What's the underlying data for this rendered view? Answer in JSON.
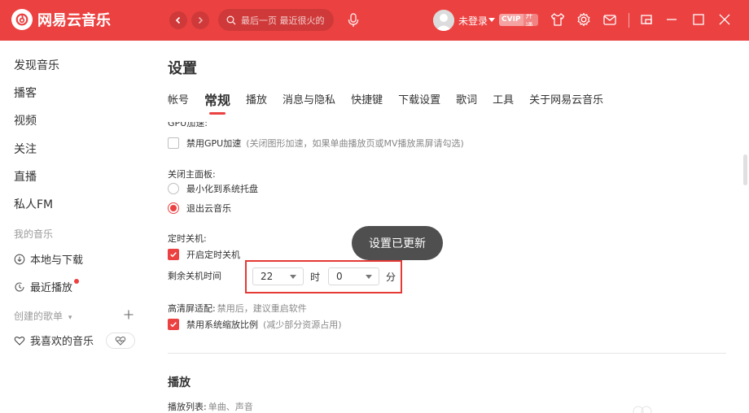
{
  "app": {
    "logo_text": "网易云音乐",
    "search_placeholder": "最后一页 最近很火的",
    "user_name": "未登录",
    "vip_badge": "CVIP",
    "vip_badge_sub": "开通"
  },
  "colors": {
    "brand_red": "#ec4141",
    "highlight_border": "#e53935",
    "toast_bg": "#3c3c3c"
  },
  "icons": {
    "back": "chevron-left-icon",
    "forward": "chevron-right-icon",
    "search": "search-icon",
    "mic": "microphone-icon",
    "skin": "tshirt-icon",
    "settings": "gear-icon",
    "mail": "envelope-icon",
    "mini_mode": "mini-player-icon",
    "minimize": "minimize-icon",
    "maximize": "maximize-icon",
    "close": "close-icon"
  },
  "sidebar": {
    "items": [
      {
        "label": "发现音乐"
      },
      {
        "label": "播客"
      },
      {
        "label": "视频"
      },
      {
        "label": "关注"
      },
      {
        "label": "直播"
      },
      {
        "label": "私人FM"
      }
    ],
    "my_music_title": "我的音乐",
    "my_music_items": [
      {
        "label": "本地与下载",
        "icon": "download-icon"
      },
      {
        "label": "最近播放",
        "icon": "clock-icon"
      }
    ],
    "created_playlists_title": "创建的歌单",
    "playlists": [
      {
        "label": "我喜欢的音乐",
        "icon": "heart-icon"
      }
    ]
  },
  "main": {
    "title": "设置",
    "tabs": [
      {
        "label": "帐号",
        "active": false
      },
      {
        "label": "常规",
        "active": true
      },
      {
        "label": "播放",
        "active": false
      },
      {
        "label": "消息与隐私",
        "active": false
      },
      {
        "label": "快捷键",
        "active": false
      },
      {
        "label": "下载设置",
        "active": false
      },
      {
        "label": "歌词",
        "active": false
      },
      {
        "label": "工具",
        "active": false
      },
      {
        "label": "关于网易云音乐",
        "active": false
      }
    ],
    "gpu": {
      "title": "GPU加速:",
      "option_label": "禁用GPU加速",
      "option_note": "(关闭图形加速，如果单曲播放页或MV播放黑屏请勾选)",
      "checked": false
    },
    "close_panel": {
      "title": "关闭主面板:",
      "options": [
        {
          "label": "最小化到系统托盘",
          "checked": false
        },
        {
          "label": "退出云音乐",
          "checked": true
        }
      ]
    },
    "timer": {
      "title": "定时关机:",
      "enable_label": "开启定时关机",
      "enabled": true,
      "remaining_label": "剩余关机时间",
      "hours_value": "22",
      "hours_unit": "时",
      "minutes_value": "0",
      "minutes_unit": "分"
    },
    "hidpi": {
      "title": "高清屏适配:",
      "note": "禁用后，建议重启软件",
      "option_label": "禁用系统缩放比例",
      "option_note": "(减少部分资源占用)",
      "checked": true
    },
    "playback_section_title": "播放",
    "playlist_setting_title": "播放列表:",
    "playlist_setting_options": "单曲、声音"
  },
  "toast": {
    "text": "设置已更新"
  }
}
